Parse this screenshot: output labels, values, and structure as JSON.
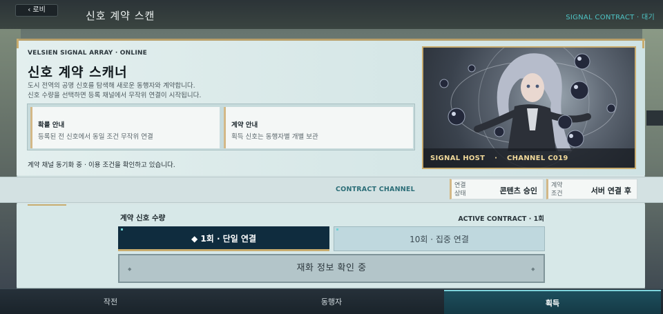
{
  "topbar": {
    "back_label": "‹ 로비",
    "title": "신호 계약 스캔",
    "status": "SIGNAL CONTRACT · 대기"
  },
  "intro": {
    "subheading": "VELSIEN SIGNAL ARRAY · ONLINE",
    "heading": "신호 계약 스캐너",
    "desc_line1": "도시 전역의 공명 신호를 탐색해 새로운 동행자와 계약합니다.",
    "desc_line2": "신호 수량을 선택하면 등록 채널에서 무작위 연결이 시작됩니다."
  },
  "info_cards": [
    {
      "title": "확률 안내",
      "text": "등록된 전 신호에서 동일 조건 무작위 연결"
    },
    {
      "title": "계약 안내",
      "text": "획득 신호는 동행자별 개별 보관"
    }
  ],
  "sync_note": "계약 채널 동기화 중 · 이용 조건을 확인하고 있습니다.",
  "art": {
    "caption_host": "SIGNAL HOST",
    "caption_sep": "·",
    "caption_channel": "CHANNEL C019"
  },
  "channel": {
    "label": "CONTRACT CHANNEL",
    "conditions": [
      {
        "key": "연결 상태",
        "value": "콘텐츠 승인"
      },
      {
        "key": "계약 조건",
        "value": "서버 연결 후"
      }
    ]
  },
  "purchase": {
    "qty_label": "계약 신호 수량",
    "active_contract": "ACTIVE CONTRACT · 1회",
    "single_label": "◆ 1회 · 단일 연결",
    "ten_label": "10회 · 집중 연결",
    "currency_label": "재화 정보 확인 중",
    "dot_glyph": "◆"
  },
  "nav": {
    "tabs": [
      "작전",
      "동행자",
      "획득"
    ],
    "active_index": 2
  },
  "colors": {
    "accent_gold": "#c9ac6e",
    "accent_teal": "#4ec4c6",
    "button_dark": "#0f2c3e"
  }
}
